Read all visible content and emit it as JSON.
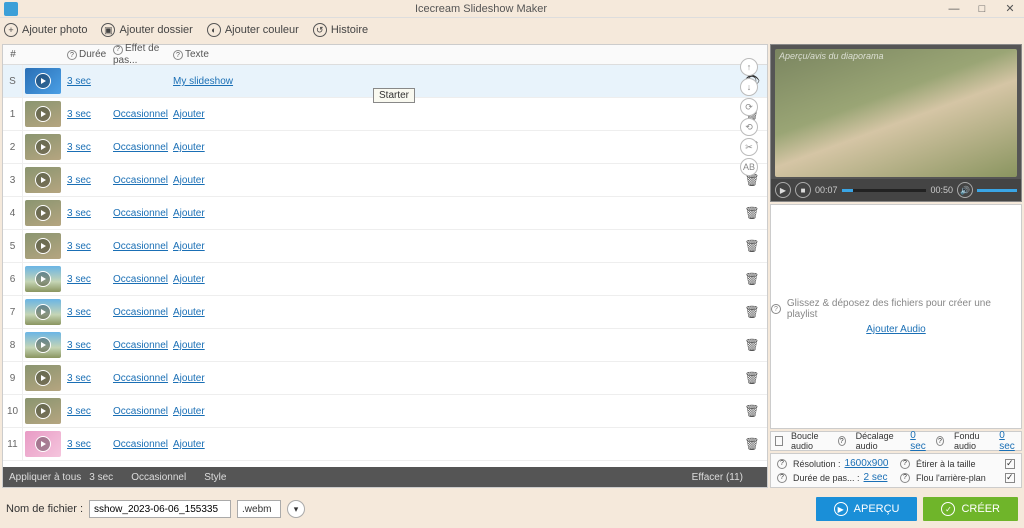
{
  "app": {
    "title": "Icecream Slideshow Maker"
  },
  "window_controls": {
    "min": "—",
    "max": "□",
    "close": "✕"
  },
  "toolbar": {
    "add_photo": "Ajouter photo",
    "add_folder": "Ajouter dossier",
    "add_color": "Ajouter couleur",
    "history": "Histoire"
  },
  "table": {
    "headers": {
      "num": "#",
      "duration": "Durée",
      "effect": "Effet de pas...",
      "text": "Texte"
    },
    "tooltip": "Starter",
    "rows": [
      {
        "n": "S",
        "dur": "3 sec",
        "eff": "",
        "txt": "My slideshow",
        "eye": true,
        "thumb": "blue"
      },
      {
        "n": "1",
        "dur": "3 sec",
        "eff": "Occasionnel",
        "txt": "Ajouter",
        "thumb": "photo"
      },
      {
        "n": "2",
        "dur": "3 sec",
        "eff": "Occasionnel",
        "txt": "Ajouter",
        "thumb": "photo"
      },
      {
        "n": "3",
        "dur": "3 sec",
        "eff": "Occasionnel",
        "txt": "Ajouter",
        "thumb": "photo"
      },
      {
        "n": "4",
        "dur": "3 sec",
        "eff": "Occasionnel",
        "txt": "Ajouter",
        "thumb": "photo"
      },
      {
        "n": "5",
        "dur": "3 sec",
        "eff": "Occasionnel",
        "txt": "Ajouter",
        "thumb": "photo"
      },
      {
        "n": "6",
        "dur": "3 sec",
        "eff": "Occasionnel",
        "txt": "Ajouter",
        "thumb": "sky"
      },
      {
        "n": "7",
        "dur": "3 sec",
        "eff": "Occasionnel",
        "txt": "Ajouter",
        "thumb": "sky"
      },
      {
        "n": "8",
        "dur": "3 sec",
        "eff": "Occasionnel",
        "txt": "Ajouter",
        "thumb": "sky"
      },
      {
        "n": "9",
        "dur": "3 sec",
        "eff": "Occasionnel",
        "txt": "Ajouter",
        "thumb": "photo"
      },
      {
        "n": "10",
        "dur": "3 sec",
        "eff": "Occasionnel",
        "txt": "Ajouter",
        "thumb": "photo"
      },
      {
        "n": "11",
        "dur": "3 sec",
        "eff": "Occasionnel",
        "txt": "Ajouter",
        "thumb": "pink"
      }
    ]
  },
  "side_tools": [
    "↑",
    "↓",
    "⟳",
    "⟲",
    "✂",
    "AB"
  ],
  "apply_row": {
    "label": "Appliquer à tous",
    "dur": "3 sec",
    "eff": "Occasionnel",
    "style": "Style",
    "clear": "Effacer (11)"
  },
  "preview": {
    "label": "Aperçu/avis du diaporama",
    "t_cur": "00:07",
    "t_end": "00:50"
  },
  "audio": {
    "hint": "Glissez & déposez des fichiers pour créer une playlist",
    "add": "Ajouter Audio",
    "loop": "Boucle audio",
    "offset_label": "Décalage audio",
    "offset_val": "0 sec",
    "fade_label": "Fondu audio",
    "fade_val": "0 sec"
  },
  "output": {
    "res_label": "Résolution :",
    "res_val": "1600x900",
    "fit_label": "Étirer à la taille",
    "dur_label": "Durée de pas... :",
    "dur_val": "2 sec",
    "blur_label": "Flou l'arrière-plan"
  },
  "bottom": {
    "fname_label": "Nom de fichier :",
    "fname_val": "sshow_2023-06-06_155335",
    "ext": ".webm",
    "preview": "APERÇU",
    "create": "CRÉER"
  }
}
